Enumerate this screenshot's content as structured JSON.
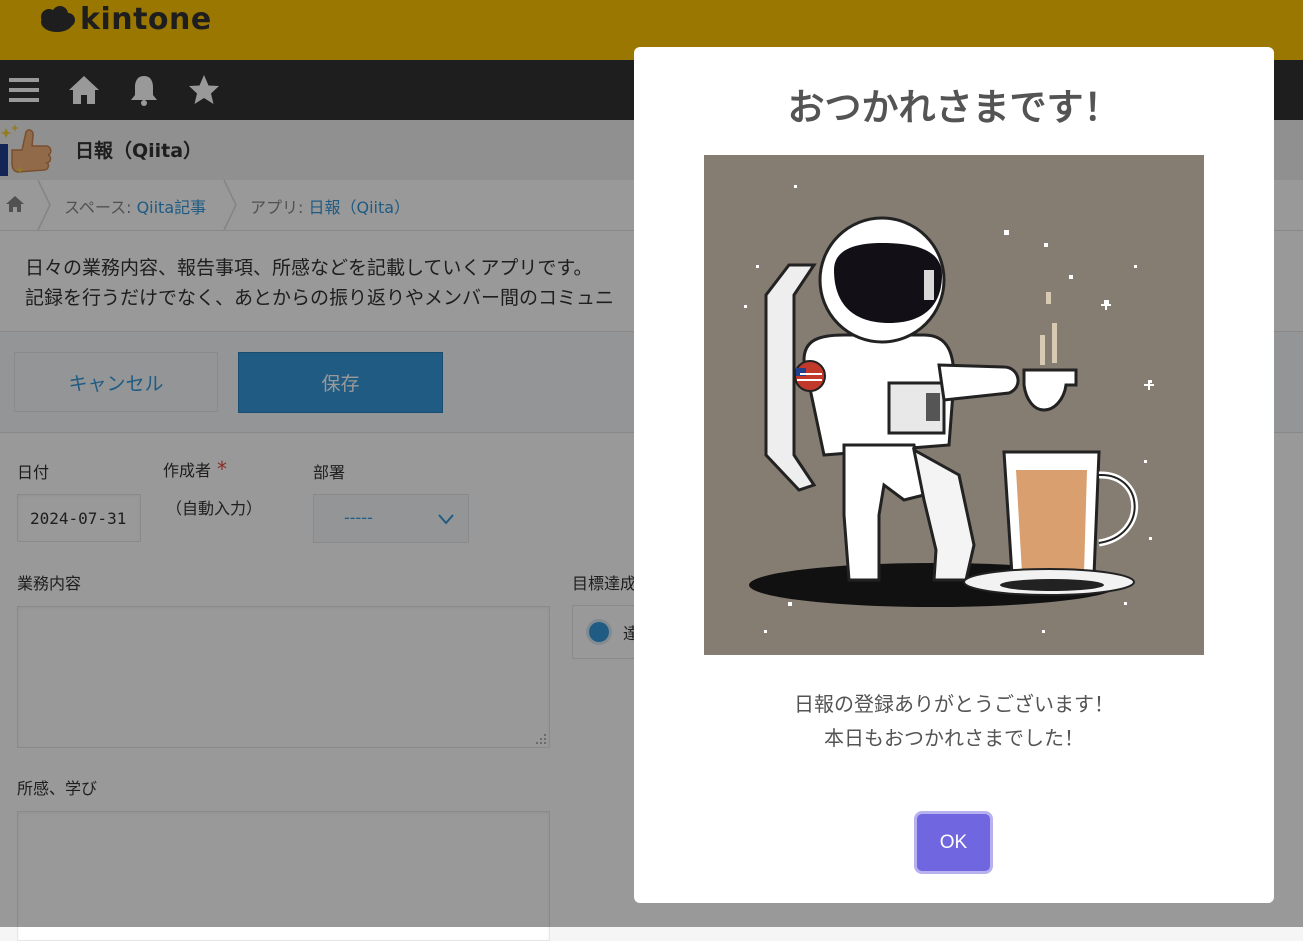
{
  "brand": {
    "name": "kintone",
    "color": "#ffc600"
  },
  "global_nav": {
    "icons": [
      "menu-icon",
      "home-icon",
      "bell-icon",
      "star-icon"
    ]
  },
  "app": {
    "title": "日報（Qiita）"
  },
  "breadcrumb": {
    "items": [
      {
        "prefix": "スペース: ",
        "link": "Qiita記事"
      },
      {
        "prefix": "アプリ: ",
        "link": "日報（Qiita）"
      }
    ]
  },
  "description": {
    "line1": "日々の業務内容、報告事項、所感などを記載していくアプリです。",
    "line2": "記録を行うだけでなく、あとからの振り返りやメンバー間のコミュニ"
  },
  "toolbar": {
    "cancel_label": "キャンセル",
    "save_label": "保存"
  },
  "form": {
    "date_label": "日付",
    "date_value": "2024-07-31",
    "author_label": "作成者",
    "required_mark": "*",
    "author_value": "（自動入力）",
    "dept_label": "部署",
    "dept_value": "-----",
    "work_label": "業務内容",
    "goal_label": "目標達成",
    "goal_option": "達",
    "thoughts_label": "所感、学び"
  },
  "modal": {
    "title": "おつかれさまです！",
    "message_line1": "日報の登録ありがとうございます！",
    "message_line2": "本日もおつかれさまでした！",
    "ok_label": "OK",
    "ok_color": "#7066e0"
  },
  "colors": {
    "accent": "#3498db",
    "nav": "#333333"
  }
}
